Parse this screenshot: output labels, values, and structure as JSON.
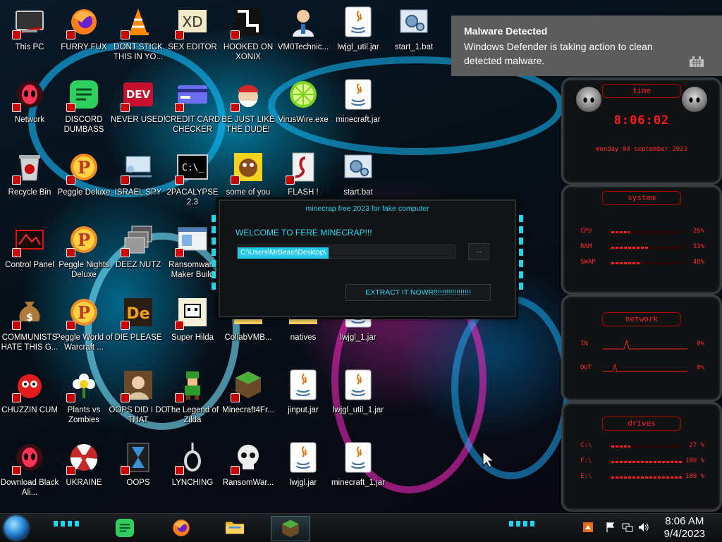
{
  "notification": {
    "title": "Malware Detected",
    "message": "Windows Defender is taking action to clean detected malware."
  },
  "desktop_icons": [
    {
      "label": "This PC",
      "icon": "computer-icon"
    },
    {
      "label": "FURRY FUX",
      "icon": "firefox-icon"
    },
    {
      "label": "DONT STICK THIS IN YO...",
      "icon": "vlc-cone-icon"
    },
    {
      "label": "SEX EDITOR",
      "icon": "hex-editor-icon"
    },
    {
      "label": "HOOKED ON XONIX",
      "icon": "xonix-game-icon"
    },
    {
      "label": "VM0Technic...",
      "icon": "doctor-icon"
    },
    {
      "label": "lwjgl_util.jar",
      "icon": "java-jar-icon"
    },
    {
      "label": "start_1.bat",
      "icon": "batch-gears-icon"
    },
    {
      "label": "Network",
      "icon": "alien-network-icon"
    },
    {
      "label": "DISCORD DUMBASS",
      "icon": "chat-app-icon"
    },
    {
      "label": "NEVER USED!",
      "icon": "dev-cpp-icon"
    },
    {
      "label": "CREDIT CARD CHECKER",
      "icon": "credit-card-icon"
    },
    {
      "label": "BE JUST LIKE THE DUDE!",
      "icon": "santa-icon"
    },
    {
      "label": "VirusWire.exe",
      "icon": "lime-icon"
    },
    {
      "label": "minecraft.jar",
      "icon": "java-jar-icon"
    },
    {
      "label": "Recycle Bin",
      "icon": "recycle-bin-icon"
    },
    {
      "label": "Peggle Deluxe",
      "icon": "peggle-icon"
    },
    {
      "label": "ISRAEL SPY",
      "icon": "network-monitor-icon"
    },
    {
      "label": "2PACALYPSE 2.3",
      "icon": "terminal-icon"
    },
    {
      "label": "some of you",
      "icon": "beaver-icon"
    },
    {
      "label": "FLASH !",
      "icon": "flash-player-icon"
    },
    {
      "label": "start.bat",
      "icon": "batch-gears-icon"
    },
    {
      "label": "Control Panel",
      "icon": "control-panel-icon"
    },
    {
      "label": "Peggle Nights Deluxe",
      "icon": "peggle-icon"
    },
    {
      "label": "DEEZ NUTZ",
      "icon": "windows-stack-icon"
    },
    {
      "label": "Ransomware Maker Build",
      "icon": "window-app-icon"
    },
    {
      "label": "COMMUNISTS HATE THIS G...",
      "icon": "money-bag-icon"
    },
    {
      "label": "Peggle World of Warcraft ...",
      "icon": "peggle-icon"
    },
    {
      "label": "DIE PLEASE",
      "icon": "die-letters-icon"
    },
    {
      "label": "Super Hilda",
      "icon": "pixel-dog-icon"
    },
    {
      "label": "CollabVMB...",
      "icon": "folder-icon"
    },
    {
      "label": "natives",
      "icon": "folder-icon"
    },
    {
      "label": "lwjgl_1.jar",
      "icon": "java-jar-icon"
    },
    {
      "label": "CHUZZIN CUM",
      "icon": "chuzzle-icon"
    },
    {
      "label": "Plants vs Zombies",
      "icon": "flower-icon"
    },
    {
      "label": "OOPS DID I DO THAT",
      "icon": "portrait-icon"
    },
    {
      "label": "The Legend of Zilda",
      "icon": "pixel-hero-icon"
    },
    {
      "label": "Minecraft4Fr...",
      "icon": "minecraft-block-icon"
    },
    {
      "label": "jinput.jar",
      "icon": "java-jar-icon"
    },
    {
      "label": "lwjgl_util_1.jar",
      "icon": "java-jar-icon"
    },
    {
      "label": "Download Black Ali...",
      "icon": "alien-network-icon"
    },
    {
      "label": "UKRAINE",
      "icon": "radiation-icon"
    },
    {
      "label": "OOPS",
      "icon": "hourglass-icon"
    },
    {
      "label": "LYNCHING",
      "icon": "noose-icon"
    },
    {
      "label": "RansomWar...",
      "icon": "skull-icon"
    },
    {
      "label": "lwjgl.jar",
      "icon": "java-jar-icon"
    },
    {
      "label": "minecraft_1.jar",
      "icon": "java-jar-icon"
    }
  ],
  "dialog": {
    "title": "minecrap free 2023 for fake computer",
    "welcome": "WELCOME TO FERE MINECRAP!!!",
    "path_value": "C:\\Users\\MrBeast\\Desktop\\",
    "browse_label": "...",
    "extract_label": "EXTRACT IT NOWR!!!!!!!!!!!!!!!!!!"
  },
  "gadgets": {
    "time": {
      "title": "time",
      "clock": "8:06:02",
      "date": "monday 04 september 2023"
    },
    "system": {
      "title": "system",
      "rows": [
        {
          "label": "CPU",
          "value": "26%",
          "level": 0.26
        },
        {
          "label": "RAM",
          "value": "53%",
          "level": 0.53
        },
        {
          "label": "SWAP",
          "value": "40%",
          "level": 0.4
        }
      ]
    },
    "network": {
      "title": "network",
      "rows": [
        {
          "label": "IN",
          "value": "0%"
        },
        {
          "label": "OUT",
          "value": "0%"
        }
      ]
    },
    "drives": {
      "title": "drives",
      "rows": [
        {
          "label": "C:\\",
          "value": "27 %",
          "level": 0.27
        },
        {
          "label": "F:\\",
          "value": "100 %",
          "level": 1.0
        },
        {
          "label": "E:\\",
          "value": "100 %",
          "level": 1.0
        }
      ]
    }
  },
  "taskbar": {
    "clock_time": "8:06 AM",
    "clock_date": "9/4/2023",
    "pinned": [
      "chat-app-icon",
      "firefox-icon",
      "file-explorer-icon",
      "minecraft-block-icon"
    ]
  },
  "colors": {
    "accent_cyan": "#1fd7ea",
    "gadget_red": "#ff2020",
    "notification_bg": "#5c5c5c"
  }
}
